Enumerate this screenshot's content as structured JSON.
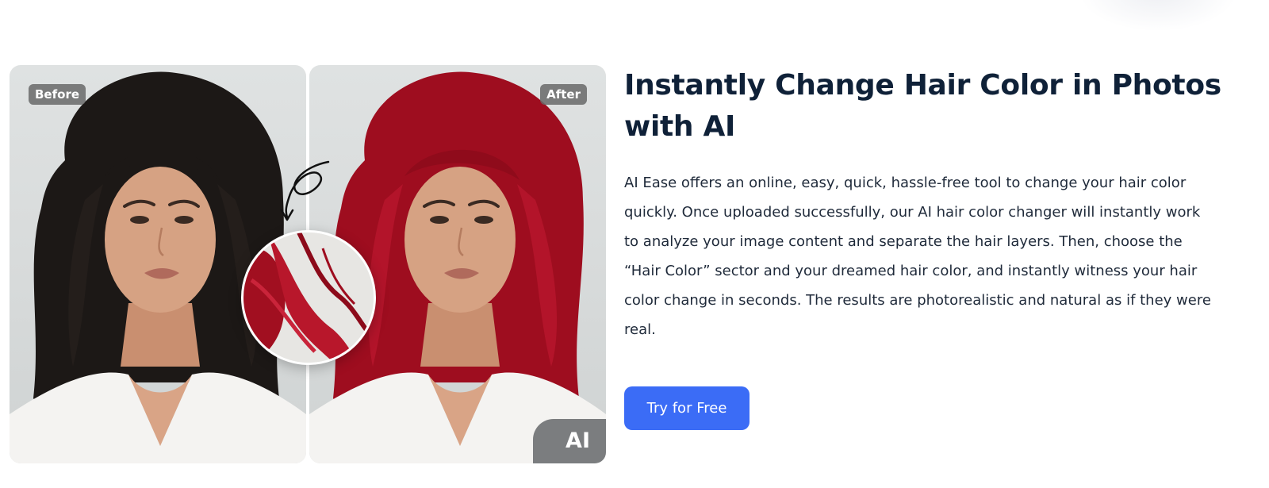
{
  "comparison": {
    "before_label": "Before",
    "after_label": "After",
    "ai_badge": "AI",
    "original_hair_color": "#1c1816",
    "new_hair_color": "#9e0d1f"
  },
  "content": {
    "title": "Instantly Change Hair Color in Photos with AI",
    "description": "AI Ease offers an online, easy, quick, hassle-free tool to change your hair color quickly. Once uploaded successfully, our AI hair color changer will instantly work to analyze your image content and separate the hair layers. Then, choose the “Hair Color” sector and your dreamed hair color, and instantly witness your hair color change in seconds. The results are photorealistic and natural as if they were real.",
    "cta_label": "Try for Free"
  },
  "colors": {
    "accent": "#3b6cf6",
    "heading": "#0f2138",
    "body_text": "#1f2a3a"
  }
}
